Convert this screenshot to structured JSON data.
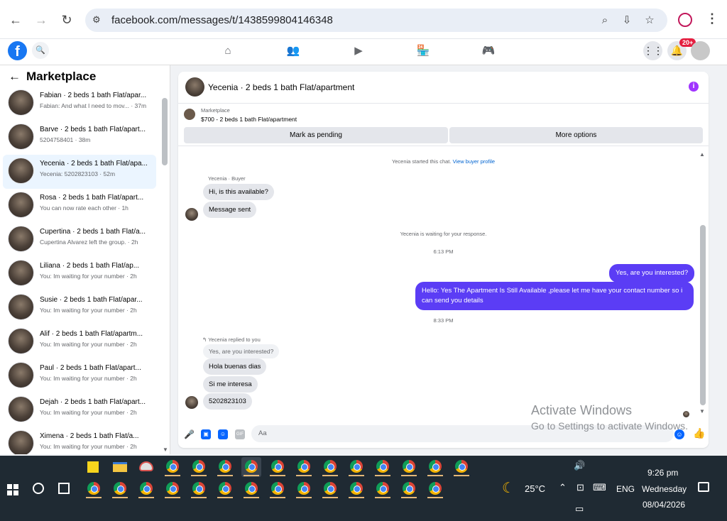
{
  "browser": {
    "url": "facebook.com/messages/t/1438599804146348"
  },
  "fb": {
    "notif_badge": "20+",
    "logo_letter": "f"
  },
  "left": {
    "title": "Marketplace",
    "conversations": [
      {
        "title": "Fabian · 2 beds 1 bath Flat/apar...",
        "sub": "Fabian: And what I need to mov... · 37m",
        "active": false
      },
      {
        "title": "Barve · 2 beds 1 bath Flat/apart...",
        "sub": "5204758401 · 38m",
        "active": false
      },
      {
        "title": "Yecenia · 2 beds 1 bath Flat/apa...",
        "sub": "Yecenia: 5202823103 · 52m",
        "active": true
      },
      {
        "title": "Rosa · 2 beds 1 bath Flat/apart...",
        "sub": "You can now rate each other · 1h",
        "active": false
      },
      {
        "title": "Cupertina · 2 beds 1 bath Flat/a...",
        "sub": "Cupertina Alvarez left the group. · 2h",
        "active": false
      },
      {
        "title": "Liliana · 2 beds 1 bath Flat/ap...",
        "sub": "You: Im waiting for your number · 2h",
        "active": false
      },
      {
        "title": "Susie · 2 beds 1 bath Flat/apar...",
        "sub": "You: Im waiting for your number · 2h",
        "active": false
      },
      {
        "title": "Alif · 2 beds 1 bath Flat/apartm...",
        "sub": "You: Im waiting for your number · 2h",
        "active": false
      },
      {
        "title": "Paul · 2 beds 1 bath Flat/apart...",
        "sub": "You: Im waiting for your number · 2h",
        "active": false
      },
      {
        "title": "Dejah · 2 beds 1 bath Flat/apart...",
        "sub": "You: Im waiting for your number · 2h",
        "active": false
      },
      {
        "title": "Ximena · 2 beds 1 bath Flat/a...",
        "sub": "You: Im waiting for your number · 2h",
        "active": false
      }
    ]
  },
  "chat": {
    "header_title": "Yecenia · 2 beds 1 bath Flat/apartment",
    "listing_label": "Marketplace",
    "listing_price": "$700 - 2 beds 1 bath Flat/apartment",
    "btn_pending": "Mark as pending",
    "btn_more": "More options",
    "started_text": "Yecenia started this chat.",
    "view_profile": "View buyer profile",
    "buyer_label": "Yecenia · Buyer",
    "msg_1": "Hi, is this available?",
    "msg_2": "Message sent",
    "waiting_text": "Yecenia is waiting for your response.",
    "time_1": "6:13 PM",
    "out_1": "Yes, are you interested?",
    "out_2": "Hello: Yes The Apartment Is Still Available ,please let me have your contact number so i can send you details",
    "time_2": "8:33 PM",
    "replied_label": "Yecenia replied to you",
    "reply_quote": "Yes, are you interested?",
    "msg_3": "Hola buenas dias",
    "msg_4": "Si me interesa",
    "msg_5": "5202823103",
    "composer_placeholder": "Aa"
  },
  "watermark": {
    "line1": "Activate Windows",
    "line2": "Go to Settings to activate Windows."
  },
  "taskbar": {
    "temperature": "25°C",
    "language": "ENG",
    "time": "9:26 pm",
    "day": "Wednesday",
    "date": "08/04/2026"
  },
  "colors": {
    "fb_blue": "#1877f2",
    "outgoing_bubble": "#5b3df5",
    "taskbar": "#1f2a33"
  }
}
